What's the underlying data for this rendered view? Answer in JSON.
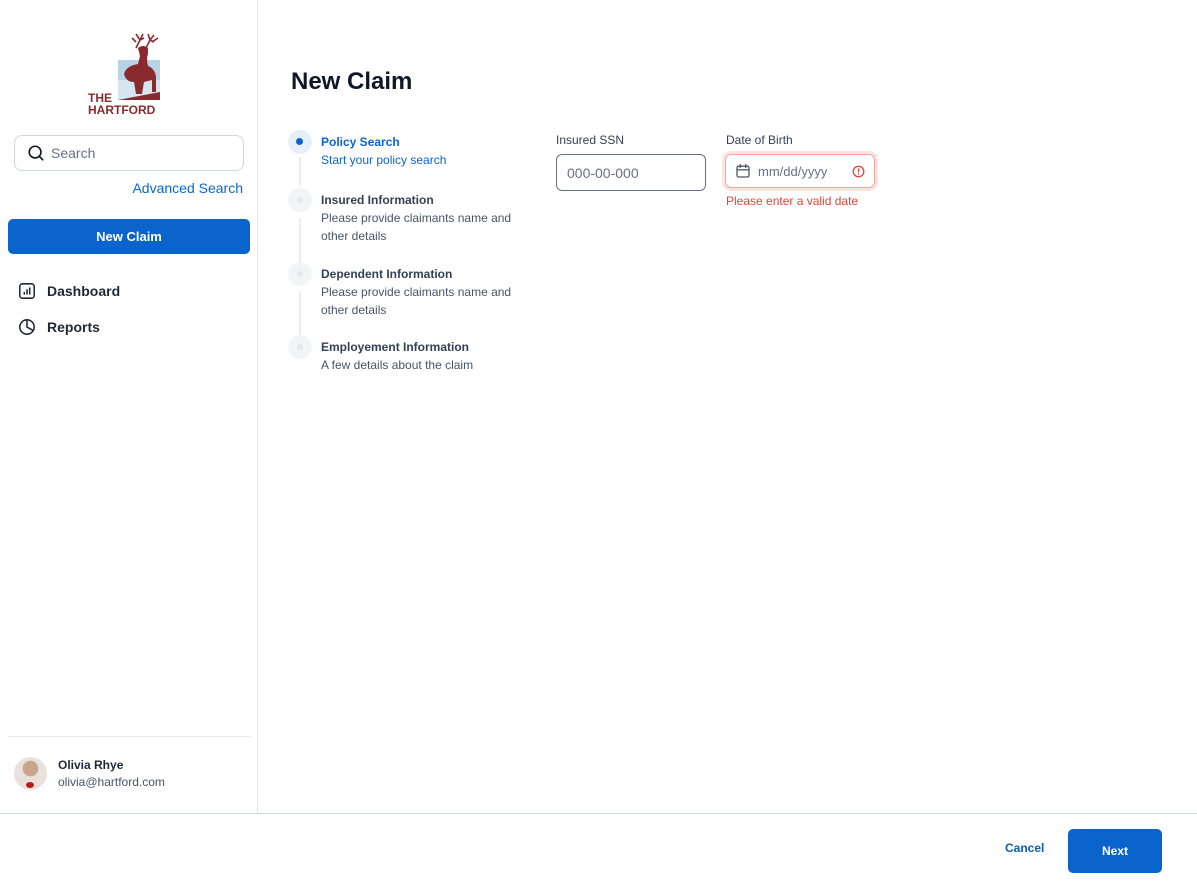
{
  "brand": {
    "name_line1": "THE",
    "name_line2": "HARTFORD",
    "color": "#8b2a2e",
    "icon": "stag-logo-icon"
  },
  "sidebar": {
    "search": {
      "placeholder": "Search",
      "icon": "search-icon"
    },
    "advanced_search_label": "Advanced Search",
    "new_claim_label": "New Claim",
    "nav": [
      {
        "label": "Dashboard",
        "icon": "bar-chart-icon"
      },
      {
        "label": "Reports",
        "icon": "pie-chart-icon"
      }
    ],
    "user": {
      "name": "Olivia Rhye",
      "email": "olivia@hartford.com"
    }
  },
  "main": {
    "title": "New Claim",
    "steps": [
      {
        "title": "Policy Search",
        "description": "Start your policy search",
        "state": "active"
      },
      {
        "title": "Insured Information",
        "description": "Please provide claimants name and other details",
        "state": "pending"
      },
      {
        "title": "Dependent Information",
        "description": "Please provide claimants name and other details",
        "state": "pending"
      },
      {
        "title": "Employement Information",
        "description": "A few details about the claim",
        "state": "pending"
      }
    ],
    "form": {
      "ssn": {
        "label": "Insured SSN",
        "placeholder": "000-00-000",
        "value": ""
      },
      "dob": {
        "label": "Date of Birth",
        "placeholder": "mm/dd/yyyy",
        "value": "",
        "error": "Please enter a valid date",
        "icon": "calendar-icon",
        "error_icon": "alert-circle-icon"
      }
    }
  },
  "footer": {
    "cancel_label": "Cancel",
    "next_label": "Next"
  },
  "colors": {
    "primary": "#0b63cc",
    "error": "#e0453a",
    "brand": "#8b2a2e"
  }
}
